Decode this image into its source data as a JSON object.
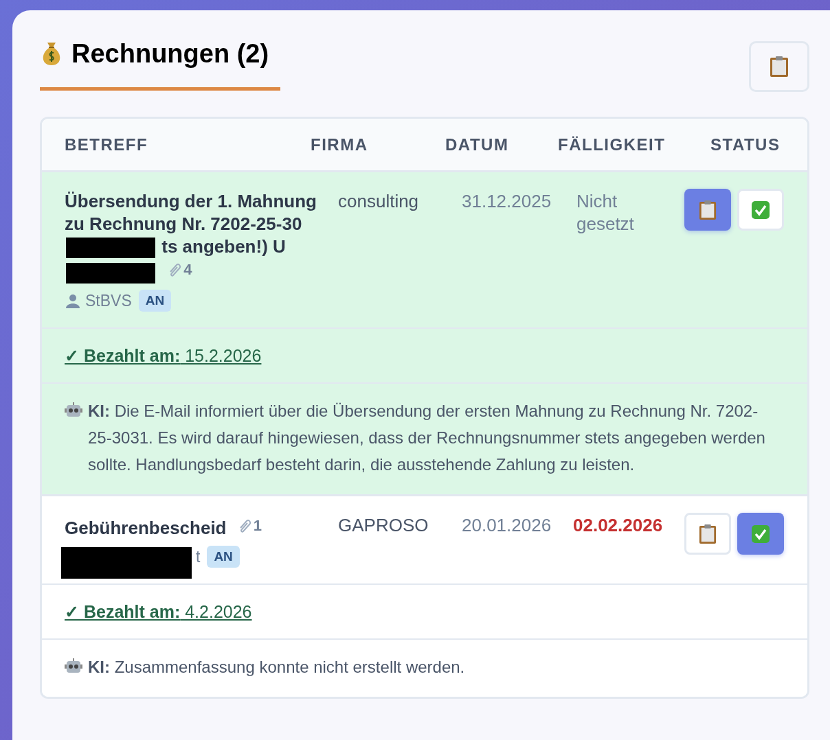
{
  "header": {
    "title": "Rechnungen (2)"
  },
  "table": {
    "columns": [
      "BETREFF",
      "FIRMA",
      "DATUM",
      "FÄLLIGKEIT",
      "STATUS"
    ],
    "rows": [
      {
        "subject": [
          {
            "kind": "text",
            "text": "Übersendung der 1. Mahnung zu Rechnung Nr. 7202-25-30"
          },
          {
            "kind": "redaction"
          },
          {
            "kind": "text",
            "text": "ts angeben!) U"
          },
          {
            "kind": "redaction"
          }
        ],
        "attachments": "4",
        "sender": "StBVS",
        "sender_redacted": false,
        "badge": "AN",
        "company": "consulting",
        "date": "31.12.2025",
        "due": "Nicht gesetzt",
        "overdue": false,
        "paid": true,
        "actions": [
          {
            "kind": "clipboard",
            "selected": true
          },
          {
            "kind": "check",
            "selected": false
          }
        ],
        "paid_line": "**✓ Bezahlt am:** 15.2.2026",
        "summary": "**KI:** Die E-Mail informiert über die Übersendung der ersten Mahnung zu Rechnung Nr. 7202-25-3031. Es wird darauf hingewiesen, dass der Rechnungsnummer stets angegeben werden sollte. Handlungsbedarf besteht darin, die ausstehende Zahlung zu leisten."
      },
      {
        "subject": [
          {
            "kind": "text",
            "text": "Gebührenbescheid"
          }
        ],
        "attachments": "1",
        "sender": "t",
        "sender_redacted": true,
        "badge": "AN",
        "company": "GAPROSO",
        "date": "20.01.2026",
        "due": "02.02.2026",
        "overdue": true,
        "paid": false,
        "actions": [
          {
            "kind": "clipboard",
            "selected": false
          },
          {
            "kind": "check",
            "selected": true
          }
        ],
        "paid_line": "**✓ Bezahlt am:** 4.2.2026",
        "summary": "**KI:** Zusammenfassung konnte nicht erstellt werden."
      }
    ]
  }
}
